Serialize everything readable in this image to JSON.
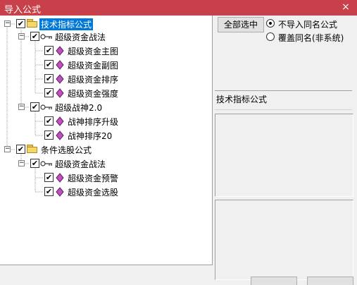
{
  "window": {
    "title": "导入公式",
    "close": "×"
  },
  "tree": {
    "nodes": [
      {
        "label": "技术指标公式",
        "checked": true
      },
      {
        "label": "超级资金战法",
        "checked": true
      },
      {
        "label": "超级资金主图",
        "checked": true
      },
      {
        "label": "超级资金副图",
        "checked": true
      },
      {
        "label": "超级资金排序",
        "checked": true
      },
      {
        "label": "超级资金强度",
        "checked": true
      },
      {
        "label": "超级战神2.0",
        "checked": true
      },
      {
        "label": "战神排序升级",
        "checked": true
      },
      {
        "label": "战神排序20",
        "checked": true
      },
      {
        "label": "条件选股公式",
        "checked": true
      },
      {
        "label": "超级资金战法",
        "checked": true
      },
      {
        "label": "超级资金预警",
        "checked": true
      },
      {
        "label": "超级资金选股",
        "checked": true
      }
    ],
    "expander_symbol": "−",
    "check_symbol": "✔"
  },
  "controls": {
    "select_all": "全部选中",
    "option_skip": "不导入同名公式",
    "option_overwrite": "覆盖同名(非系统)",
    "selected_option": "skip"
  },
  "info": {
    "text": "技术指标公式"
  },
  "colors": {
    "titlebar": "#c8414a",
    "selection": "#0078d7",
    "diamond": "#c050c0"
  }
}
